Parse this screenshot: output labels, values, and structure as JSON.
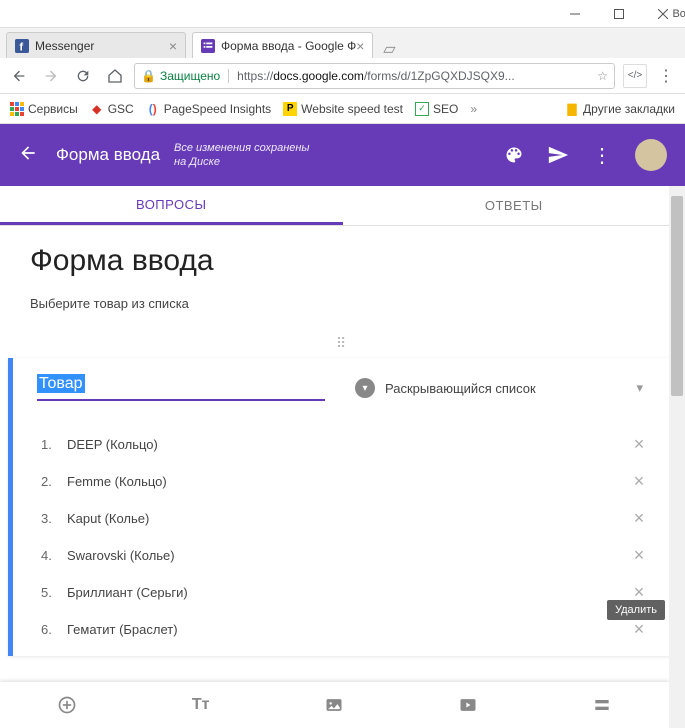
{
  "window": {
    "user": "Boris"
  },
  "tabs": [
    {
      "label": "Messenger",
      "active": false
    },
    {
      "label": "Форма ввода - Google Ф",
      "active": true
    }
  ],
  "addressbar": {
    "secure_label": "Защищено",
    "url_prefix": "https://",
    "url_host": "docs.google.com",
    "url_path": "/forms/d/1ZpGQXDJSQX9..."
  },
  "bookmarks": {
    "services": "Сервисы",
    "gsc": "GSC",
    "ps": "PageSpeed Insights",
    "wst": "Website speed test",
    "seo": "SEO",
    "other": "Другие закладки"
  },
  "header": {
    "title": "Форма ввода",
    "status_l1": "Все изменения сохранены",
    "status_l2": "на Диске"
  },
  "qa_tabs": {
    "questions": "ВОПРОСЫ",
    "responses": "ОТВЕТЫ"
  },
  "form": {
    "title": "Форма ввода",
    "description": "Выберите товар из списка"
  },
  "question": {
    "title": "Товар",
    "type_label": "Раскрывающийся список",
    "options": [
      "DEEP (Кольцо)",
      "Femme (Кольцо)",
      "Kaput (Колье)",
      "Swarovski (Колье)",
      "Бриллиант (Серьги)",
      "Гематит (Браслет)"
    ]
  },
  "tooltip": "Удалить"
}
